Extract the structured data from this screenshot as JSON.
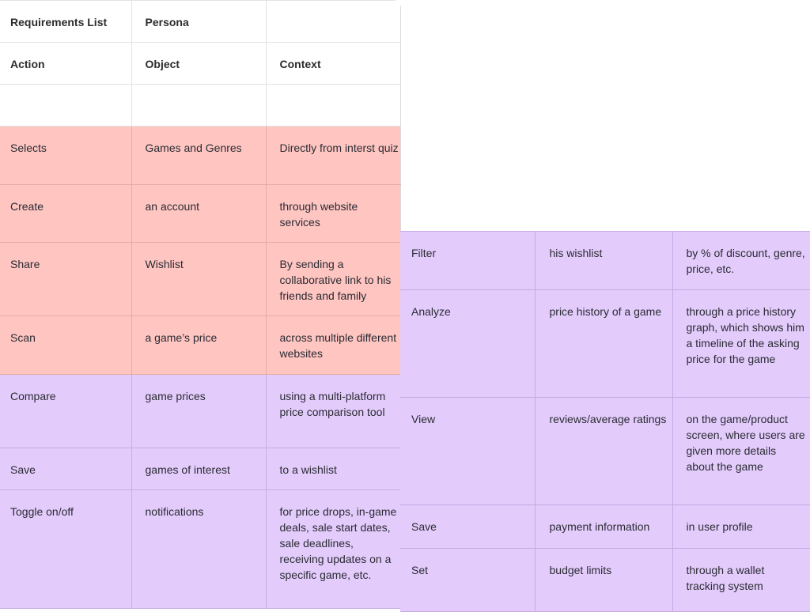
{
  "left_table": {
    "title_row": [
      "Requirements List",
      "Persona",
      ""
    ],
    "header_row": [
      "Action",
      "Object",
      "Context"
    ],
    "spacer_row": [
      "",
      "",
      ""
    ],
    "rows": [
      {
        "color": "pink",
        "action": "Selects",
        "object": "Games and Genres",
        "context": "Directly from interst quiz"
      },
      {
        "color": "pink",
        "action": "Create",
        "object": "an account",
        "context": "through website services"
      },
      {
        "color": "pink",
        "action": "Share",
        "object": "Wishlist",
        "context": "By sending a collaborative link to his friends and family"
      },
      {
        "color": "pink",
        "action": "Scan",
        "object": "a game’s price",
        "context": "across multiple different websites"
      },
      {
        "color": "purple",
        "action": "Compare",
        "object": "game prices",
        "context": "using a multi-platform price comparison tool"
      },
      {
        "color": "purple",
        "action": "Save",
        "object": "games of interest",
        "context": "to a wishlist"
      },
      {
        "color": "purple",
        "action": "Toggle on/off",
        "object": "notifications",
        "context": "for price drops, in-game deals, sale start dates, sale deadlines, receiving updates on a specific game, etc."
      }
    ]
  },
  "right_table": {
    "rows": [
      {
        "color": "purple",
        "action": "Filter",
        "object": "his wishlist",
        "context": "by % of discount, genre, price, etc."
      },
      {
        "color": "purple",
        "action": "Analyze",
        "object": "price history of a game",
        "context": "through a price history graph, which shows him a timeline of the asking price for the game"
      },
      {
        "color": "purple",
        "action": "View",
        "object": "reviews/average ratings",
        "context": "on the game/product screen, where users are given more details about the game"
      },
      {
        "color": "purple",
        "action": "Save",
        "object": "payment information",
        "context": "in user profile"
      },
      {
        "color": "purple",
        "action": "Set",
        "object": "budget limits",
        "context": "through a wallet tracking system"
      }
    ]
  },
  "colors": {
    "pink_row": "#fec5c1",
    "purple_row": "#e3ccfc",
    "header_bg": "#ffffff"
  }
}
